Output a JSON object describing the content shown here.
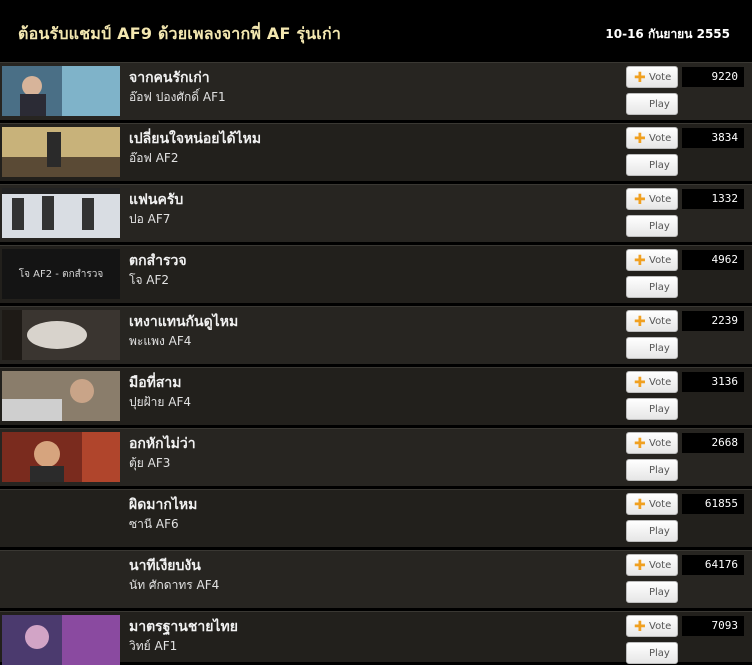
{
  "header": {
    "title": "ต้อนรับแชมป์ AF9 ด้วยเพลงจากพี่ AF รุ่นเก่า",
    "date": "10-16 กันยายน 2555"
  },
  "buttons": {
    "vote_label": "Vote",
    "play_label": "Play",
    "plus_glyph": "✚"
  },
  "songs": [
    {
      "title": "จากคนรักเก่า",
      "artist": "อ๊อฟ ปองศักดิ์ AF1",
      "votes": "9220",
      "thumb_text": ""
    },
    {
      "title": "เปลี่ยนใจหน่อยได้ไหม",
      "artist": "อ๊อฟ AF2",
      "votes": "3834",
      "thumb_text": ""
    },
    {
      "title": "แฟนครับ",
      "artist": "ปอ AF7",
      "votes": "1332",
      "thumb_text": ""
    },
    {
      "title": "ตกสำรวจ",
      "artist": "โจ AF2",
      "votes": "4962",
      "thumb_text": "โจ AF2 - ตกสำรวจ"
    },
    {
      "title": "เหงาแทนกันดูไหม",
      "artist": "พะแพง AF4",
      "votes": "2239",
      "thumb_text": ""
    },
    {
      "title": "มือที่สาม",
      "artist": "ปุยฝ้าย AF4",
      "votes": "3136",
      "thumb_text": ""
    },
    {
      "title": "อกหักไม่ว่า",
      "artist": "ตุ้ย AF3",
      "votes": "2668",
      "thumb_text": ""
    },
    {
      "title": "ผิดมากไหม",
      "artist": "ซานี AF6",
      "votes": "61855",
      "thumb_text": ""
    },
    {
      "title": "นาทีเงียบงัน",
      "artist": "นัท ศักดาทร AF4",
      "votes": "64176",
      "thumb_text": ""
    },
    {
      "title": "มาตรฐานชายไทย",
      "artist": "วิทย์ AF1",
      "votes": "7093",
      "thumb_text": ""
    }
  ]
}
